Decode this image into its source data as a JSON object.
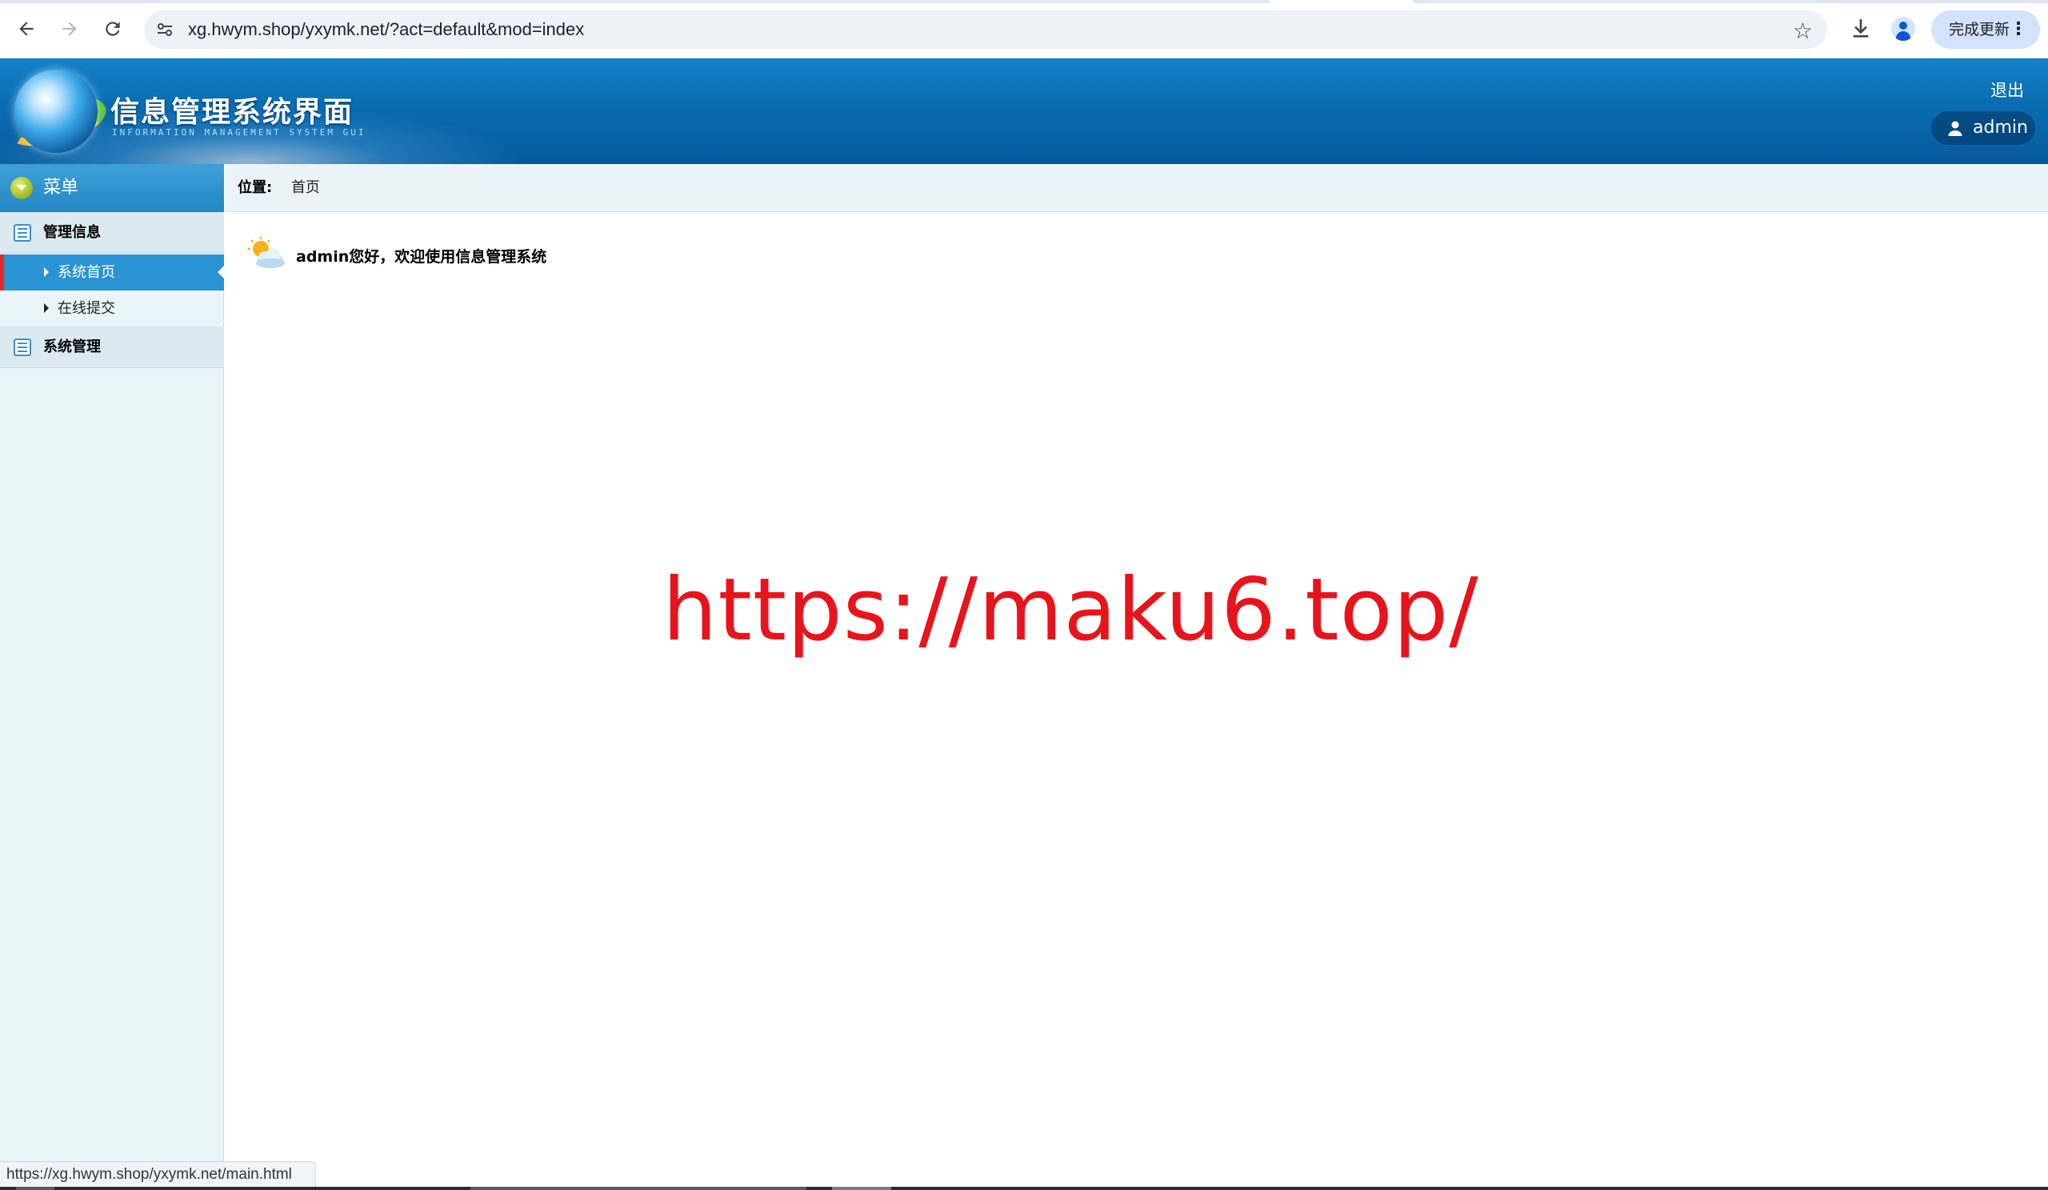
{
  "browser": {
    "url": "xg.hwym.shop/yxymk.net/?act=default&mod=index",
    "update_label": "完成更新",
    "status_url": "https://xg.hwym.shop/yxymk.net/main.html"
  },
  "header": {
    "title": "信息管理系统界面",
    "subtitle": "INFORMATION MANAGEMENT SYSTEM GUI",
    "logout_label": "退出",
    "username": "admin"
  },
  "sidebar": {
    "menu_label": "菜单",
    "groups": [
      {
        "title": "管理信息",
        "items": [
          {
            "label": "系统首页",
            "active": true
          },
          {
            "label": "在线提交",
            "active": false
          }
        ]
      },
      {
        "title": "系统管理",
        "items": []
      }
    ]
  },
  "main": {
    "breadcrumb_label": "位置:",
    "breadcrumb_value": "首页",
    "welcome": "admin您好，欢迎使用信息管理系统",
    "watermark": "https://maku6.top/"
  },
  "colors": {
    "header_blue": "#0a6cb1",
    "sidebar_bg": "#eaf5f9",
    "active_item": "#2a93d3",
    "active_marker": "#e02b2b",
    "watermark_red": "#e8141c"
  }
}
